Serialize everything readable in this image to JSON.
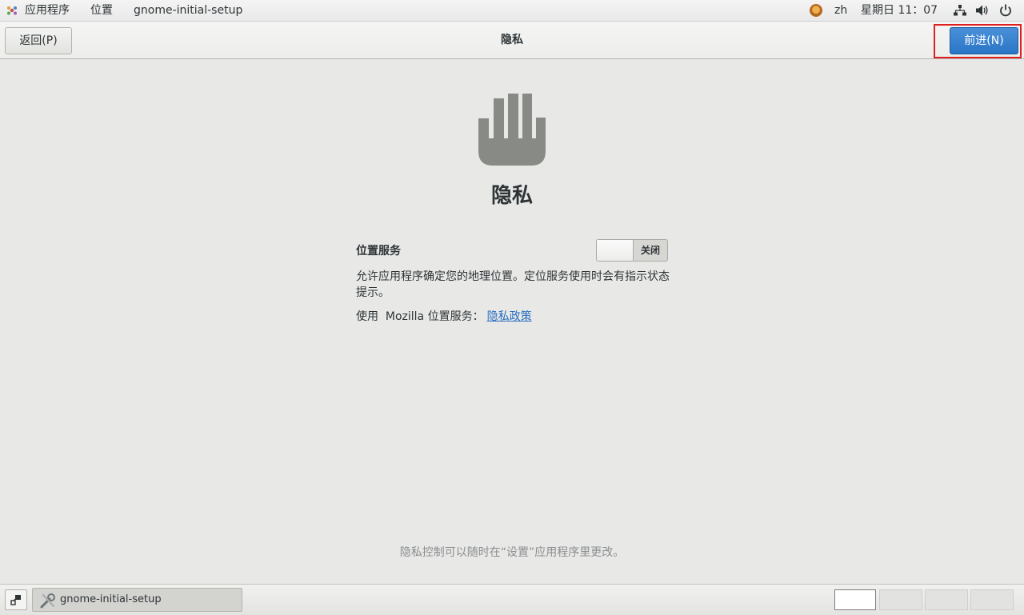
{
  "top_panel": {
    "applications": "应用程序",
    "places": "位置",
    "app_name": "gnome-initial-setup",
    "language": "zh",
    "clock": "星期日 11：07",
    "icons": [
      "applications-icon",
      "user-avatar-icon",
      "network-icon",
      "volume-icon",
      "power-icon"
    ]
  },
  "header": {
    "back_label": "返回(P)",
    "title": "隐私",
    "next_label": "前进(N)"
  },
  "main": {
    "icon": "hand-stop-icon",
    "heading": "隐私",
    "location_label": "位置服务",
    "switch_state": "关闭",
    "description": "允许应用程序确定您的地理位置。定位服务使用时会有指示状态提示。",
    "mozilla_prefix": "使用  Mozilla 位置服务：",
    "privacy_link": "隐私政策",
    "footer_note": "隐私控制可以随时在“设置”应用程序里更改。"
  },
  "taskbar": {
    "task_label": "gnome-initial-setup",
    "workspaces": 4,
    "active_workspace": 1
  },
  "colors": {
    "background": "#e8e8e7",
    "accent": "#2a76c6",
    "link": "#2a6fbf",
    "icon_gray": "#888a85",
    "highlight": "#e02020"
  }
}
